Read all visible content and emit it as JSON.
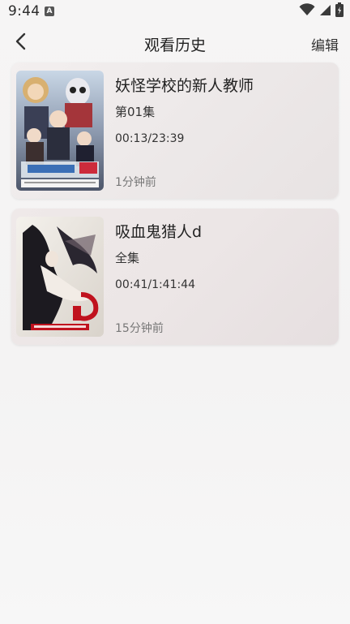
{
  "status_bar": {
    "time": "9:44",
    "notification_icon": "a-icon",
    "icons": [
      "wifi-icon",
      "signal-icon",
      "battery-icon"
    ]
  },
  "header": {
    "title": "观看历史",
    "edit_label": "编辑",
    "back_icon": "chevron-left-icon"
  },
  "annotation": {
    "arrow_color": "#e53935"
  },
  "history": [
    {
      "title": "妖怪学校的新人教师",
      "episode": "第01集",
      "progress": "00:13/23:39",
      "watched_ago": "1分钟前"
    },
    {
      "title": "吸血鬼猎人d",
      "episode": "全集",
      "progress": "00:41/1:41:44",
      "watched_ago": "15分钟前"
    }
  ]
}
